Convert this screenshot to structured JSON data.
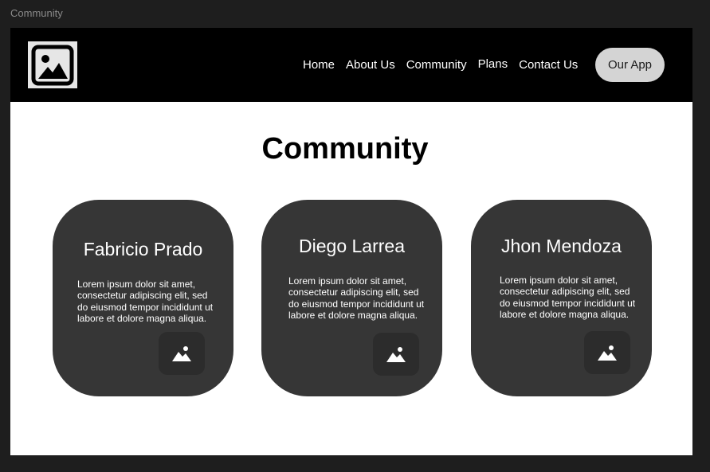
{
  "frame": {
    "label": "Community"
  },
  "nav": {
    "logo_icon": "image-icon",
    "links": [
      "Home",
      "About Us",
      "Community",
      "Plans",
      "Contact Us"
    ],
    "cta_label": "Our App"
  },
  "main": {
    "title": "Community",
    "cards": [
      {
        "name": "Fabricio Prado",
        "description": "Lorem ipsum dolor sit amet, consectetur adipiscing elit, sed do eiusmod tempor incididunt ut labore et dolore magna aliqua.",
        "icon": "image-icon"
      },
      {
        "name": "Diego Larrea",
        "description": "Lorem ipsum dolor sit amet, consectetur adipiscing elit, sed do eiusmod tempor incididunt ut labore et dolore magna aliqua.",
        "icon": "image-icon"
      },
      {
        "name": "Jhon Mendoza",
        "description": "Lorem ipsum dolor sit amet, consectetur adipiscing elit, sed do eiusmod tempor incididunt ut labore et dolore magna aliqua.",
        "icon": "image-icon"
      }
    ]
  },
  "colors": {
    "canvas": "#1e1e1e",
    "navbar": "#000000",
    "card": "#363636",
    "button": "#d4d4d4"
  }
}
